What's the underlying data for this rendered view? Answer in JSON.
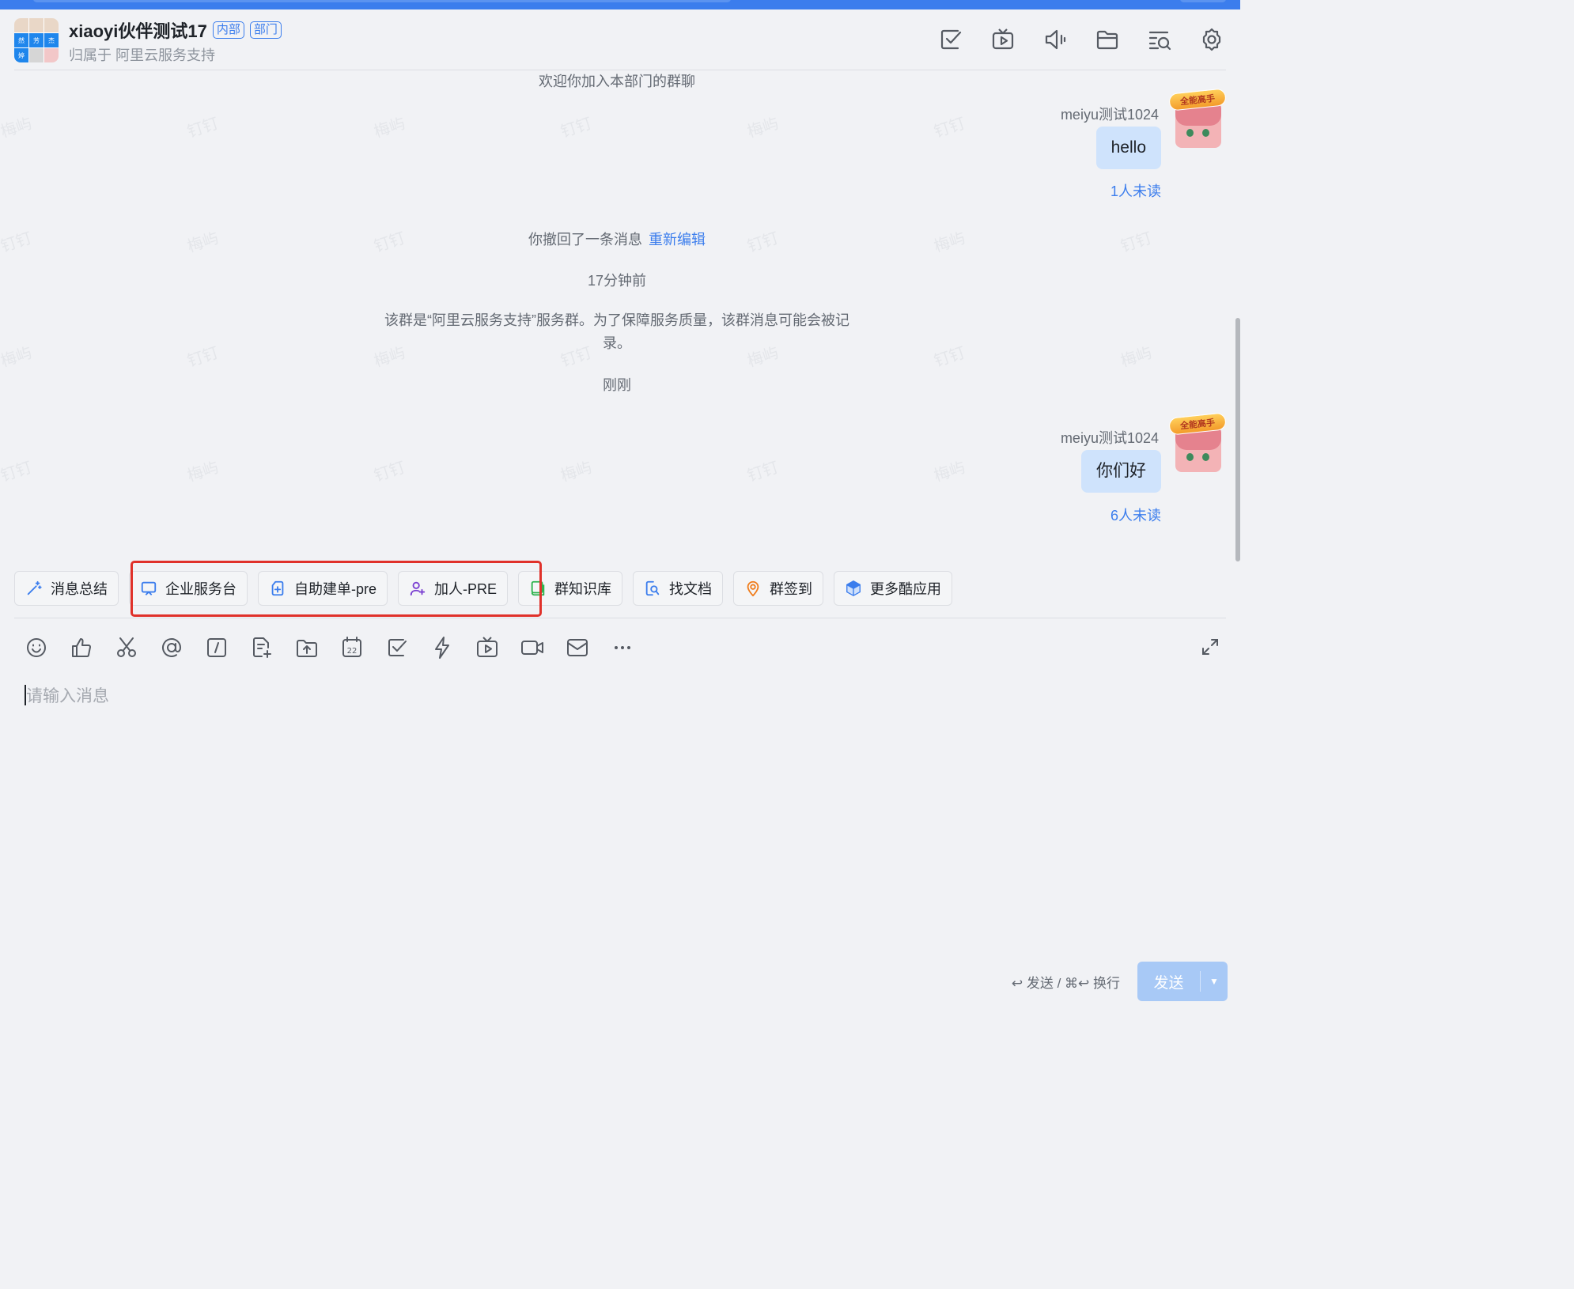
{
  "header": {
    "title": "xiaoyi伙伴测试17",
    "tags": [
      "内部",
      "部门"
    ],
    "subtitle": "归属于 阿里云服务支持",
    "avatar_chars": [
      "然",
      "芳",
      "杰",
      "婷"
    ],
    "tools": [
      "task-icon",
      "live-icon",
      "announcement-icon",
      "folder-icon",
      "search-history-icon",
      "settings-icon"
    ]
  },
  "watermark": {
    "a": "梅屿",
    "b": "钉钉"
  },
  "messages": {
    "welcome": "欢迎你加入本部门的群聊",
    "msg1": {
      "sender": "meiyu测试1024",
      "text": "hello",
      "unread": "1人未读",
      "badge": "全能高手"
    },
    "recall": {
      "text": "你撤回了一条消息",
      "link": "重新编辑"
    },
    "time1": "17分钟前",
    "notice": "该群是“阿里云服务支持”服务群。为了保障服务质量，该群消息可能会被记录。",
    "time2": "刚刚",
    "msg2": {
      "sender": "meiyu测试1024",
      "text": "你们好",
      "unread": "6人未读",
      "badge": "全能高手"
    }
  },
  "quickbar": [
    {
      "label": "消息总结",
      "icon": "magic-wand-icon",
      "color": "#3b7ded"
    },
    {
      "label": "企业服务台",
      "icon": "monitor-icon",
      "color": "#3b7ded"
    },
    {
      "label": "自助建单-pre",
      "icon": "new-document-icon",
      "color": "#3b7ded"
    },
    {
      "label": "加人-PRE",
      "icon": "add-person-icon",
      "color": "#7a3fd1"
    },
    {
      "label": "群知识库",
      "icon": "book-icon",
      "color": "#2bb24c"
    },
    {
      "label": "找文档",
      "icon": "doc-search-icon",
      "color": "#3b7ded"
    },
    {
      "label": "群签到",
      "icon": "location-icon",
      "color": "#f07c1b"
    },
    {
      "label": "更多酷应用",
      "icon": "cube-icon",
      "color": "#3b7ded"
    }
  ],
  "toolbar": [
    "emoji-icon",
    "thumbs-up-icon",
    "scissors-icon",
    "at-icon",
    "slash-command-icon",
    "note-add-icon",
    "upload-folder-icon",
    "calendar-icon",
    "todo-check-icon",
    "ding-lightning-icon",
    "live-tv-icon",
    "video-call-icon",
    "mail-icon",
    "more-icon"
  ],
  "calendar_day": "22",
  "input": {
    "placeholder": "请输入消息"
  },
  "footer": {
    "hint": "↩ 发送 / ⌘↩ 换行",
    "send_label": "发送"
  }
}
